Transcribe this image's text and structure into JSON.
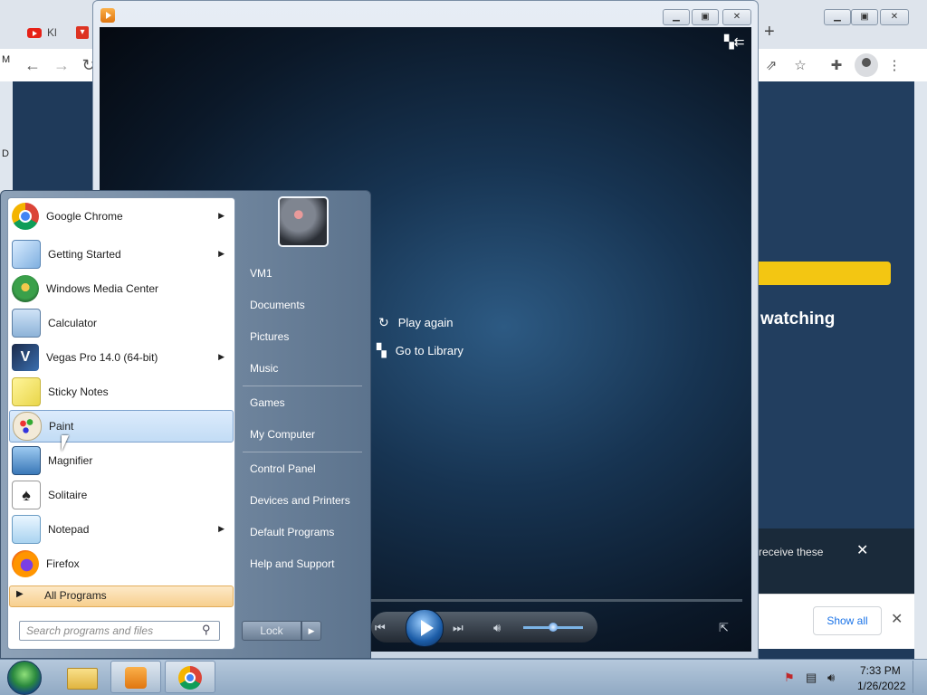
{
  "chrome": {
    "tabs": [
      {
        "label": "Kl",
        "icon": "youtube-icon"
      },
      {
        "label": "",
        "icon": "red-app-icon"
      }
    ],
    "new_tab": "+",
    "left_edge_m": "M",
    "left_edge_d": "D",
    "page_heading": "watching",
    "notification": {
      "text": "receive these",
      "close": "✕"
    },
    "downloads": {
      "show_all": "Show all",
      "close": "✕"
    }
  },
  "media_player": {
    "title_icon": "media-player-icon",
    "actions": [
      {
        "label": "Play again",
        "icon": "replay-icon"
      },
      {
        "label": "Go to Library",
        "icon": "library-icon"
      }
    ]
  },
  "start_menu": {
    "programs": [
      {
        "label": "Google Chrome",
        "icon": "chrome-icon",
        "has_submenu": true
      },
      {
        "label": "Getting Started",
        "icon": "getting-started-icon",
        "has_submenu": true
      },
      {
        "label": "Windows Media Center",
        "icon": "media-center-icon",
        "has_submenu": false
      },
      {
        "label": "Calculator",
        "icon": "calculator-icon",
        "has_submenu": false
      },
      {
        "label": "Vegas Pro 14.0 (64-bit)",
        "icon": "vegas-icon",
        "has_submenu": true
      },
      {
        "label": "Sticky Notes",
        "icon": "sticky-notes-icon",
        "has_submenu": false
      },
      {
        "label": "Paint",
        "icon": "paint-icon",
        "has_submenu": false,
        "highlighted": true
      },
      {
        "label": "Magnifier",
        "icon": "magnifier-icon",
        "has_submenu": false
      },
      {
        "label": "Solitaire",
        "icon": "solitaire-icon",
        "has_submenu": false
      },
      {
        "label": "Notepad",
        "icon": "notepad-icon",
        "has_submenu": true
      },
      {
        "label": "Firefox",
        "icon": "firefox-icon",
        "has_submenu": false
      }
    ],
    "all_programs": "All Programs",
    "search_placeholder": "Search programs and files",
    "right_items": {
      "user": "VM1",
      "documents": "Documents",
      "pictures": "Pictures",
      "music": "Music",
      "games": "Games",
      "computer": "My Computer",
      "control_panel": "Control Panel",
      "devices": "Devices and Printers",
      "default_programs": "Default Programs",
      "help": "Help and Support"
    },
    "lock": "Lock"
  },
  "taskbar": {
    "time": "7:33 PM",
    "date": "1/26/2022"
  }
}
